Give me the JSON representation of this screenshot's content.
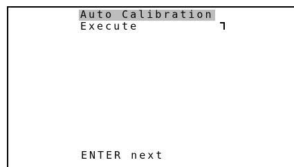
{
  "screen": {
    "title": "Auto Calibration",
    "menu_item_label": "Execute",
    "footer_hint": "ENTER next",
    "cursor_icon": "corner-marker-icon",
    "colors": {
      "background": "#ffffff",
      "text": "#000000",
      "title_highlight": "#bdbdbd"
    }
  }
}
